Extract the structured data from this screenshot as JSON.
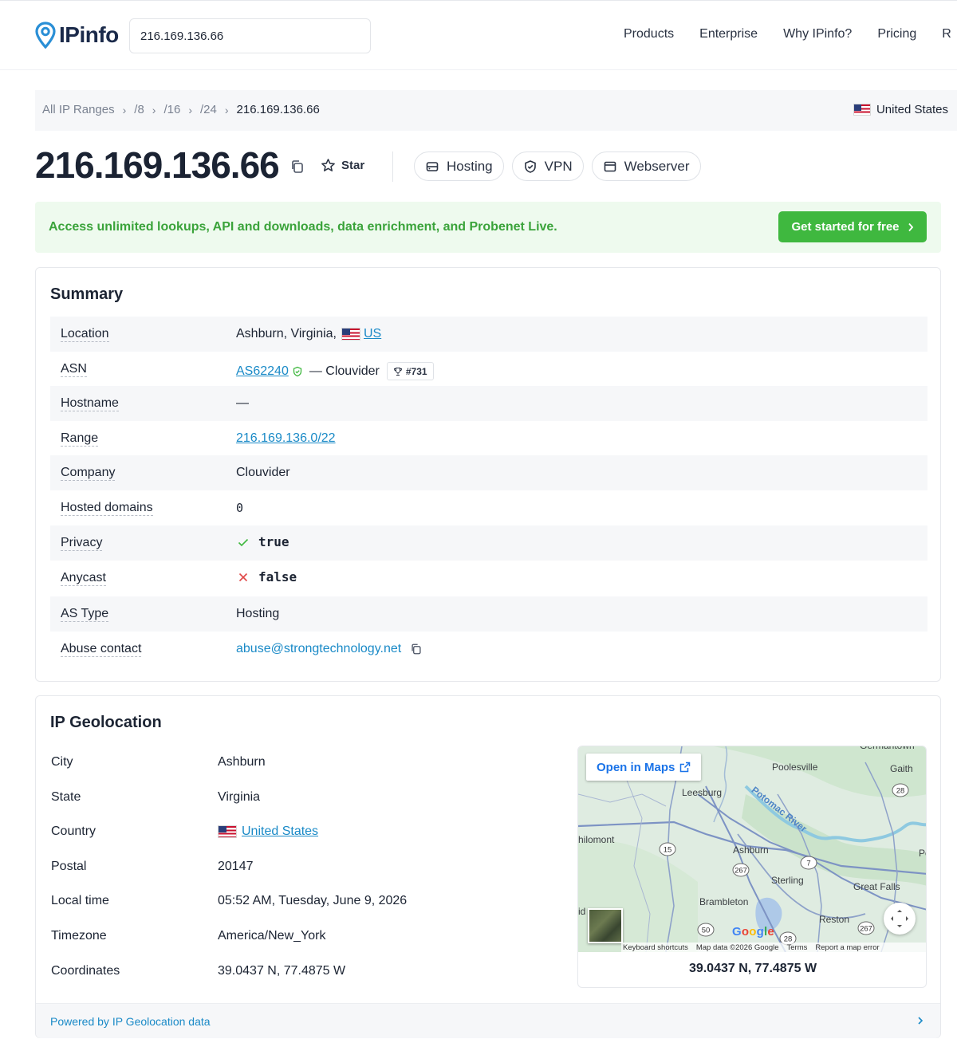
{
  "header": {
    "logo_text": "IPinfo",
    "search_value": "216.169.136.66",
    "nav": [
      "Products",
      "Enterprise",
      "Why IPinfo?",
      "Pricing",
      "R"
    ]
  },
  "breadcrumb": {
    "items": [
      "All IP Ranges",
      "/8",
      "/16",
      "/24"
    ],
    "current": "216.169.136.66",
    "country": "United States"
  },
  "title": {
    "ip": "216.169.136.66",
    "star_label": "Star",
    "tags": [
      "Hosting",
      "VPN",
      "Webserver"
    ]
  },
  "promo": {
    "text": "Access unlimited lookups, API and downloads, data enrichment, and Probenet Live.",
    "button": "Get started for free"
  },
  "summary": {
    "title": "Summary",
    "location_label": "Location",
    "location_value": "Ashburn, Virginia,",
    "location_country": "US",
    "asn_label": "ASN",
    "asn_value": "AS62240",
    "asn_name": "— Clouvider",
    "asn_rank": "#731",
    "hostname_label": "Hostname",
    "hostname_value": "—",
    "range_label": "Range",
    "range_value": "216.169.136.0/22",
    "company_label": "Company",
    "company_value": "Clouvider",
    "hosted_label": "Hosted domains",
    "hosted_value": "0",
    "privacy_label": "Privacy",
    "privacy_value": "true",
    "anycast_label": "Anycast",
    "anycast_value": "false",
    "astype_label": "AS Type",
    "astype_value": "Hosting",
    "abuse_label": "Abuse contact",
    "abuse_value": "abuse@strongtechnology.net"
  },
  "geo": {
    "title": "IP Geolocation",
    "city_label": "City",
    "city_value": "Ashburn",
    "state_label": "State",
    "state_value": "Virginia",
    "country_label": "Country",
    "country_value": "United States",
    "postal_label": "Postal",
    "postal_value": "20147",
    "localtime_label": "Local time",
    "localtime_value": "05:52 AM, Tuesday, June 9, 2026",
    "timezone_label": "Timezone",
    "timezone_value": "America/New_York",
    "coords_label": "Coordinates",
    "coords_value": "39.0437 N, 77.4875 W",
    "footer_link": "Powered by IP Geolocation data"
  },
  "map": {
    "open_label": "Open in Maps",
    "coords": "39.0437 N, 77.4875 W",
    "footer": [
      "Keyboard shortcuts",
      "Map data ©2026 Google",
      "Terms",
      "Report a map error"
    ],
    "places": [
      "Poolesville",
      "Leesburg",
      "Potomac River",
      "Ashburn",
      "Sterling",
      "Great Falls",
      "Brambleton",
      "Reston",
      "hilomont",
      "Germantown",
      "Gaith",
      "Po",
      "id"
    ],
    "route_shields": [
      "28",
      "15",
      "267",
      "7",
      "50",
      "28",
      "267"
    ],
    "brand": "Google"
  }
}
